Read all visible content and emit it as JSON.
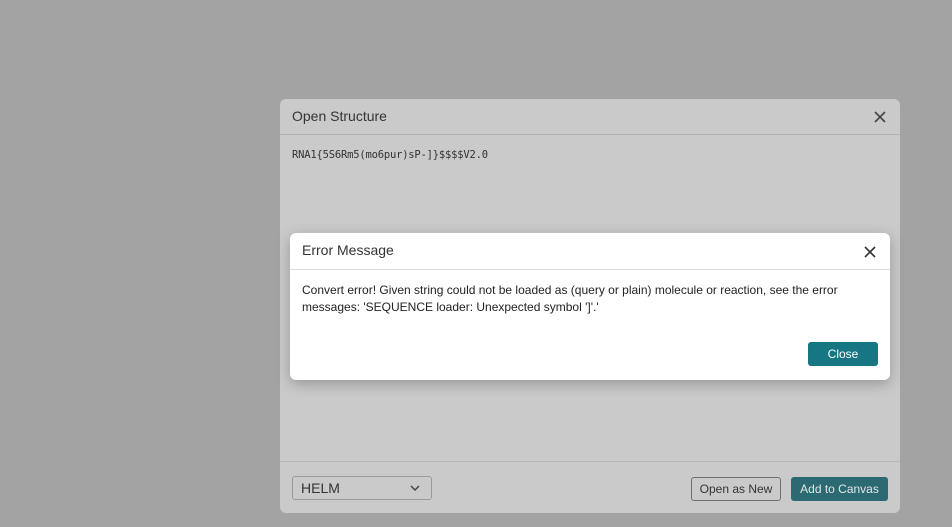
{
  "open_dialog": {
    "title": "Open Structure",
    "close_icon": "close-icon",
    "content_text": "RNA1{5S6Rm5(mo6pur)sP-]}$$$$V2.0",
    "format_select": {
      "value": "HELM",
      "icon": "chevron-down-icon"
    },
    "open_as_new_label": "Open as New",
    "add_to_canvas_label": "Add to Canvas"
  },
  "error_dialog": {
    "title": "Error Message",
    "close_icon": "close-icon",
    "message": "Convert error! Given string could not be loaded as (query or plain) molecule or reaction, see the error messages: 'SEQUENCE loader: Unexpected symbol ']'.'",
    "close_label": "Close"
  },
  "colors": {
    "backdrop": "#a3a3a3",
    "accent": "#167782"
  }
}
